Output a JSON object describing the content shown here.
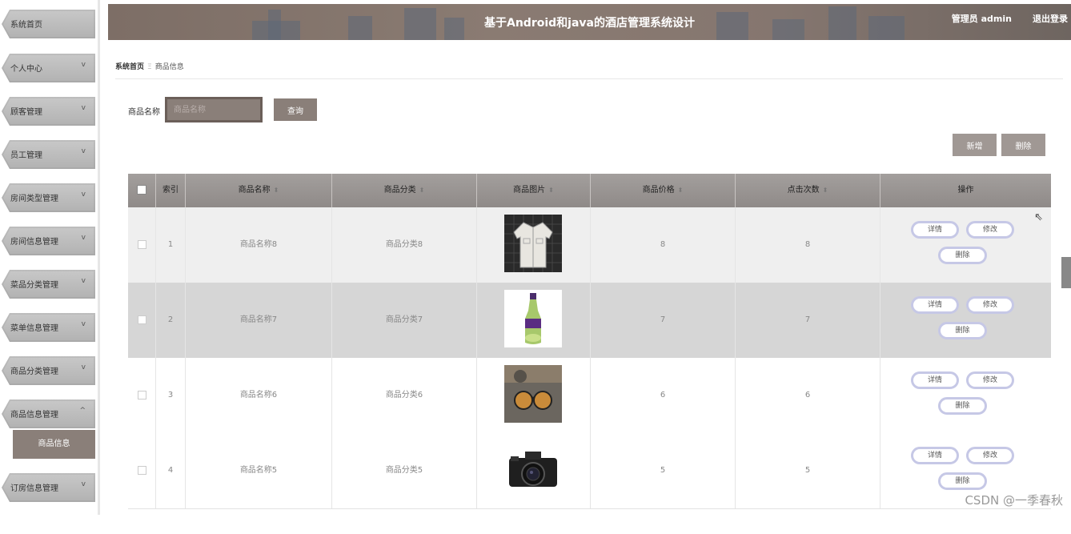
{
  "header": {
    "title": "基于Android和java的酒店管理系统设计",
    "user": "管理员 admin",
    "logout": "退出登录"
  },
  "sidebar": {
    "items": [
      {
        "label": "系统首页",
        "chevron": ""
      },
      {
        "label": "个人中心",
        "chevron": "v"
      },
      {
        "label": "顾客管理",
        "chevron": "v"
      },
      {
        "label": "员工管理",
        "chevron": "v"
      },
      {
        "label": "房间类型管理",
        "chevron": "v"
      },
      {
        "label": "房间信息管理",
        "chevron": "v"
      },
      {
        "label": "菜品分类管理",
        "chevron": "v"
      },
      {
        "label": "菜单信息管理",
        "chevron": "v"
      },
      {
        "label": "商品分类管理",
        "chevron": "v"
      },
      {
        "label": "商品信息管理",
        "chevron": "^"
      },
      {
        "label": "订房信息管理",
        "chevron": "v"
      }
    ],
    "sub_item": "商品信息"
  },
  "breadcrumb": {
    "home": "系统首页",
    "sep": "Ξ",
    "current": "商品信息"
  },
  "search": {
    "label": "商品名称",
    "placeholder": "商品名称",
    "button": "查询"
  },
  "actions": {
    "add": "新增",
    "delete": "删除"
  },
  "table": {
    "headers": {
      "index": "索引",
      "name": "商品名称",
      "category": "商品分类",
      "image": "商品图片",
      "price": "商品价格",
      "clicks": "点击次数",
      "ops": "操作"
    },
    "rows": [
      {
        "index": "1",
        "name": "商品名称8",
        "category": "商品分类8",
        "price": "8",
        "clicks": "8",
        "image": "jacket-image"
      },
      {
        "index": "2",
        "name": "商品名称7",
        "category": "商品分类7",
        "price": "7",
        "clicks": "7",
        "image": "drink-bottle-image"
      },
      {
        "index": "3",
        "name": "商品名称6",
        "category": "商品分类6",
        "price": "6",
        "clicks": "6",
        "image": "sunglasses-image"
      },
      {
        "index": "4",
        "name": "商品名称5",
        "category": "商品分类5",
        "price": "5",
        "clicks": "5",
        "image": "camera-image"
      }
    ],
    "op_labels": {
      "detail": "详情",
      "edit": "修改",
      "delete": "删除"
    }
  },
  "watermark": "CSDN @一季春秋",
  "colors": {
    "accent": "#8a7f79",
    "op_border": "#c6c8e6",
    "row_alt": "#d6d6d6"
  }
}
